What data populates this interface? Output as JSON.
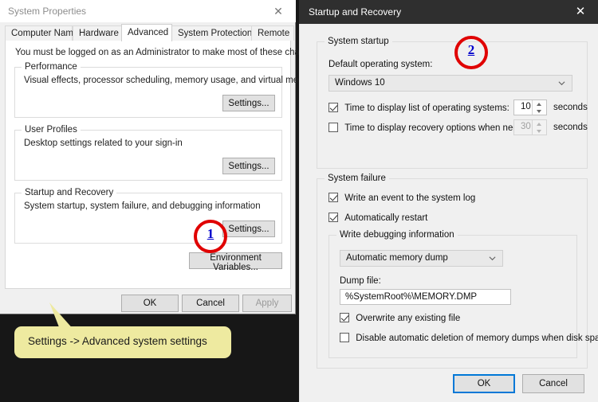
{
  "left_dialog": {
    "title": "System Properties",
    "close_icon": "close-icon",
    "tabs": [
      {
        "label": "Computer Name",
        "active": false
      },
      {
        "label": "Hardware",
        "active": false
      },
      {
        "label": "Advanced",
        "active": true
      },
      {
        "label": "System Protection",
        "active": false
      },
      {
        "label": "Remote",
        "active": false
      }
    ],
    "admin_notice": "You must be logged on as an Administrator to make most of these changes.",
    "groups": [
      {
        "legend": "Performance",
        "description": "Visual effects, processor scheduling, memory usage, and virtual memory",
        "button": "Settings..."
      },
      {
        "legend": "User Profiles",
        "description": "Desktop settings related to your sign-in",
        "button": "Settings..."
      },
      {
        "legend": "Startup and Recovery",
        "description": "System startup, system failure, and debugging information",
        "button": "Settings..."
      }
    ],
    "environment_variables_button": "Environment Variables...",
    "footer_buttons": [
      {
        "label": "OK",
        "disabled": false
      },
      {
        "label": "Cancel",
        "disabled": false
      },
      {
        "label": "Apply",
        "disabled": true
      }
    ]
  },
  "right_dialog": {
    "title": "Startup and Recovery",
    "close_icon": "close-icon",
    "system_startup": {
      "legend": "System startup",
      "default_os_label": "Default operating system:",
      "default_os_value": "Windows 10",
      "timeout_os": {
        "label": "Time to display list of operating systems:",
        "checked": true,
        "value": "10",
        "unit": "seconds"
      },
      "timeout_recovery": {
        "label": "Time to display recovery options when needed",
        "checked": false,
        "value": "30",
        "unit": "seconds"
      }
    },
    "system_failure": {
      "legend": "System failure",
      "write_event": {
        "label": "Write an event to the system log",
        "checked": true
      },
      "auto_restart": {
        "label": "Automatically restart",
        "checked": true
      },
      "debug_group": {
        "legend": "Write debugging information",
        "dump_type_value": "Automatic memory dump",
        "dump_file_label": "Dump file:",
        "dump_file_value": "%SystemRoot%\\MEMORY.DMP",
        "overwrite": {
          "label": "Overwrite any existing file",
          "checked": true
        },
        "disable_deletion": {
          "label": "Disable automatic deletion of memory dumps when disk space is l",
          "checked": false
        }
      }
    },
    "footer_buttons": [
      {
        "label": "OK",
        "focused": true
      },
      {
        "label": "Cancel",
        "focused": false
      }
    ]
  },
  "annotations": {
    "badge_one": "1",
    "badge_two": "2",
    "callout_text": "Settings -> Advanced system settings",
    "badge_ring_color": "#e00000",
    "badge_number_color": "#0000cc",
    "callout_bg_color": "#eeeaa0"
  }
}
